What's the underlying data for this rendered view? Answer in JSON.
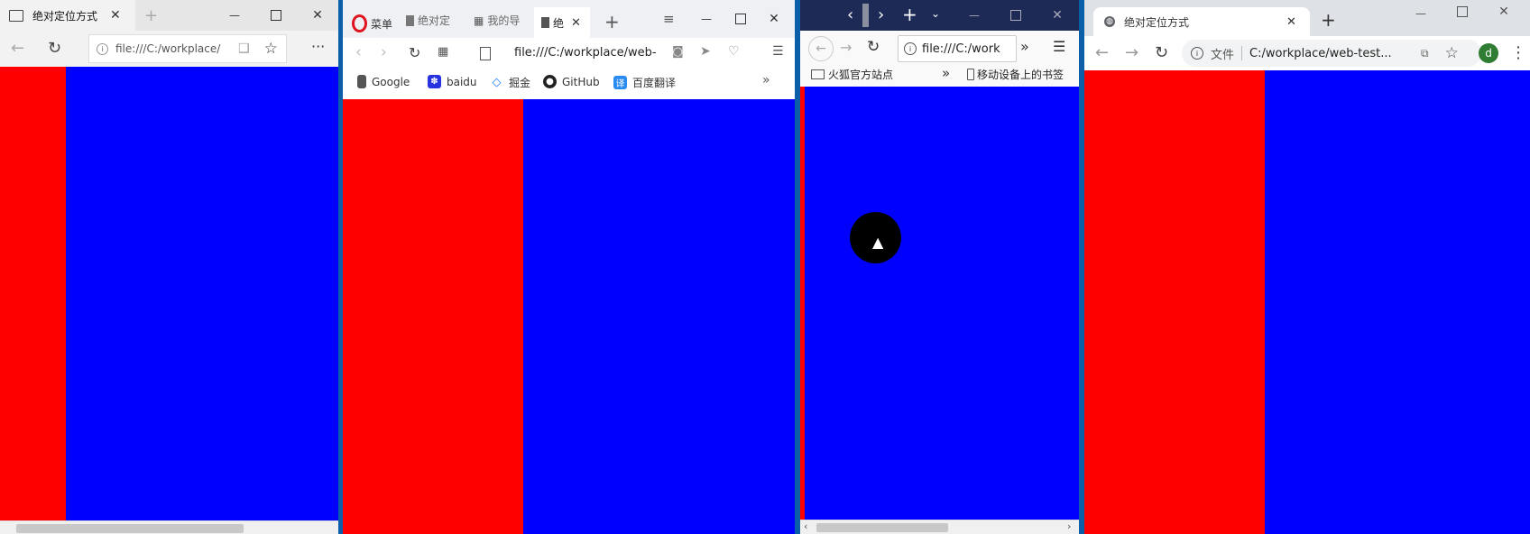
{
  "edge": {
    "tab_title": "绝对定位方式",
    "address": "file:///C:/workplace/"
  },
  "opera": {
    "menu_label": "菜单",
    "tabs": [
      "绝对定",
      "我的导",
      "绝"
    ],
    "address": "file:///C:/workplace/web-",
    "bookmarks": [
      "Google",
      "baidu",
      "掘金",
      "GitHub",
      "百度翻译"
    ]
  },
  "firefox": {
    "address": "file:///C:/work",
    "bookmark_left": "火狐官方站点",
    "bookmark_right": "移动设备上的书签"
  },
  "chrome": {
    "tab_title": "绝对定位方式",
    "security_label": "文件",
    "address": "C:/workplace/web-test...",
    "avatar_letter": "d"
  },
  "colors": {
    "red_column": "#ff0000",
    "blue_area": "#0000ff",
    "desktop": "#0a5fa8"
  }
}
